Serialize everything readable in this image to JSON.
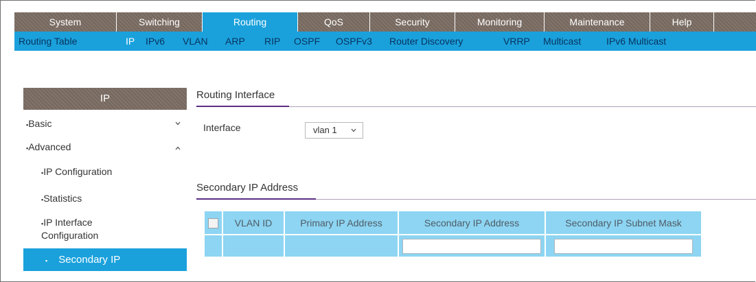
{
  "top_nav": {
    "tabs": [
      {
        "label": "System",
        "active": false
      },
      {
        "label": "Switching",
        "active": false
      },
      {
        "label": "Routing",
        "active": true
      },
      {
        "label": "QoS",
        "active": false
      },
      {
        "label": "Security",
        "active": false
      },
      {
        "label": "Monitoring",
        "active": false
      },
      {
        "label": "Maintenance",
        "active": false
      },
      {
        "label": "Help",
        "active": false
      }
    ]
  },
  "sub_nav": {
    "items": [
      {
        "label": "Routing Table",
        "active": false
      },
      {
        "label": "IP",
        "active": true
      },
      {
        "label": "IPv6",
        "active": false
      },
      {
        "label": "VLAN",
        "active": false
      },
      {
        "label": "ARP",
        "active": false
      },
      {
        "label": "RIP",
        "active": false
      },
      {
        "label": "OSPF",
        "active": false
      },
      {
        "label": "OSPFv3",
        "active": false
      },
      {
        "label": "Router Discovery",
        "active": false
      },
      {
        "label": "VRRP",
        "active": false
      },
      {
        "label": "Multicast",
        "active": false
      },
      {
        "label": "IPv6 Multicast",
        "active": false
      }
    ]
  },
  "sidebar": {
    "title": "IP",
    "items": [
      {
        "label": "Basic",
        "chevron": "chevron-down-icon"
      },
      {
        "label": "Advanced",
        "chevron": "chevron-up-icon"
      },
      {
        "label": "IP Configuration"
      },
      {
        "label": "Statistics"
      },
      {
        "label": "IP Interface Configuration"
      },
      {
        "label": "Secondary IP",
        "active": true
      }
    ],
    "bullet": "▪"
  },
  "main": {
    "routing_interface": {
      "title": "Routing Interface",
      "interface_label": "Interface",
      "interface_value": "vlan 1"
    },
    "secondary_ip": {
      "title": "Secondary IP Address",
      "columns": [
        "VLAN ID",
        "Primary IP Address",
        "Secondary IP Address",
        "Secondary IP Subnet Mask"
      ],
      "row": {
        "vlan_id": "",
        "primary_ip": "",
        "secondary_ip": "",
        "subnet_mask": ""
      }
    }
  },
  "colors": {
    "nav_brown": "#7b6d63",
    "accent_blue": "#1aa1dc",
    "table_blue": "#8dd5f2",
    "section_purple": "#5a2d82"
  }
}
